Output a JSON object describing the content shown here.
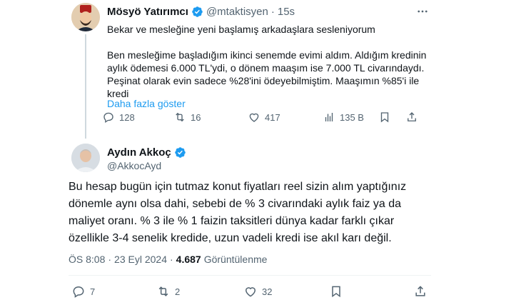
{
  "tweet1": {
    "name": "Mösyö Yatırımcı",
    "handle": "@mtaktisyen",
    "separator": "·",
    "time": "15s",
    "body_line1": "Bekar ve mesleğine yeni başlamış arkadaşlara sesleniyorum",
    "body_para2": "Ben mesleğime başladığım ikinci senemde evimi aldım. Aldığım kredinin aylık ödemesi 6.000 TL'ydi, o dönem maaşım ise 7.000 TL civarındaydı. Peşinat olarak evin sadece %28'ini ödeyebilmiştim. Maaşımın %85'i ile kredi",
    "show_more": "Daha fazla göster",
    "replies": "128",
    "retweets": "16",
    "likes": "417",
    "views": "135 B"
  },
  "tweet2": {
    "name": "Aydın Akkoç",
    "handle": "@AkkocAyd",
    "body": "Bu hesap bugün için tutmaz konut fiyatları reel sizin alım yaptığınız dönemle aynı olsa dahi, sebebi de % 3 civarındaki aylık faiz ya da maliyet oranı. % 3 ile % 1 faizin taksitleri dünya kadar farklı çıkar özellikle 3-4 senelik kredide, uzun vadeli kredi ise akıl karı değil.",
    "time": "ÖS 8:08",
    "separator": "·",
    "date": "23 Eyl 2024",
    "separator2": "·",
    "views_count": "4.687",
    "views_label": "Görüntülenme",
    "replies": "7",
    "retweets": "2",
    "likes": "32"
  },
  "colors": {
    "accent": "#1d9bf0",
    "text": "#0f1419",
    "muted": "#536471",
    "border": "#cfd9de"
  },
  "icons": [
    "verified-icon",
    "more-icon",
    "reply-icon",
    "retweet-icon",
    "like-icon",
    "views-icon",
    "bookmark-icon",
    "share-icon"
  ]
}
